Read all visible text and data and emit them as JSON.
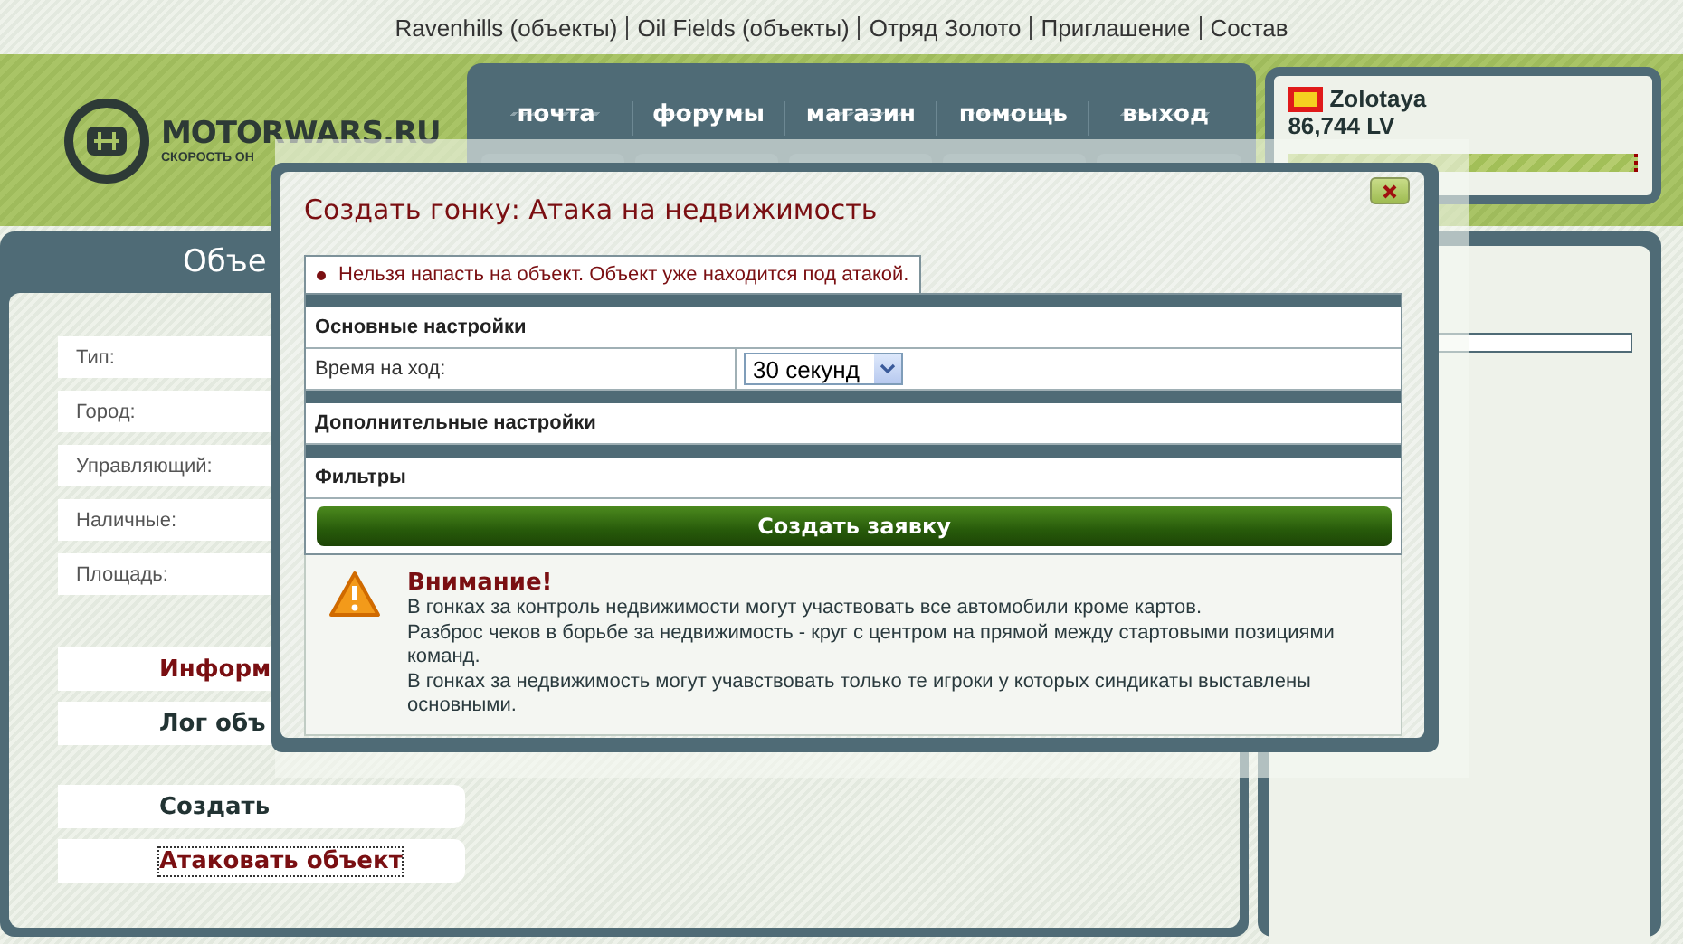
{
  "top_links": [
    "Ravenhills (объекты)",
    "Oil Fields (объекты)",
    "Отряд Золото",
    "Приглашение",
    "Состав"
  ],
  "logo": {
    "name": "MOTORWARS.RU",
    "tagline": "СКОРОСТЬ ОН"
  },
  "nav": [
    "почта",
    "форумы",
    "магазин",
    "помощь",
    "выход"
  ],
  "user": {
    "name": "Zolotaya",
    "money": "86,744 LV"
  },
  "object_panel": {
    "title": "Объе",
    "fields": [
      "Тип:",
      "Город:",
      "Управляющий:",
      "Наличные:",
      "Площадь:"
    ],
    "buttons": [
      {
        "label": "Информ",
        "highlighted": true,
        "focused": false
      },
      {
        "label": "Лог объ",
        "highlighted": false,
        "focused": false
      },
      {
        "label": "Создать",
        "highlighted": false,
        "focused": false
      },
      {
        "label": "Атаковать объект",
        "highlighted": true,
        "focused": true
      }
    ]
  },
  "dialog": {
    "title": "Создать гонку: Атака на недвижимость",
    "error": "Нельзя напасть на объект. Объект уже находится под атакой.",
    "sections": [
      {
        "title": "Основные настройки",
        "rows": [
          {
            "label": "Время на ход:",
            "value": "30 секунд"
          }
        ]
      },
      {
        "title": "Дополнительные настройки"
      },
      {
        "title": "Фильтры"
      }
    ],
    "submit": "Создать заявку",
    "warning": {
      "title": "Внимание!",
      "lines": [
        "В гонках за контроль недвижимости могут участвовать все автомобили кроме картов.",
        "Разброс чеков в борьбе за недвижимость - круг с центром на прямой между стартовыми позициями команд.",
        "В гонках за недвижимость могут учавствовать только те игроки у которых синдикаты выставлены основными."
      ]
    }
  }
}
